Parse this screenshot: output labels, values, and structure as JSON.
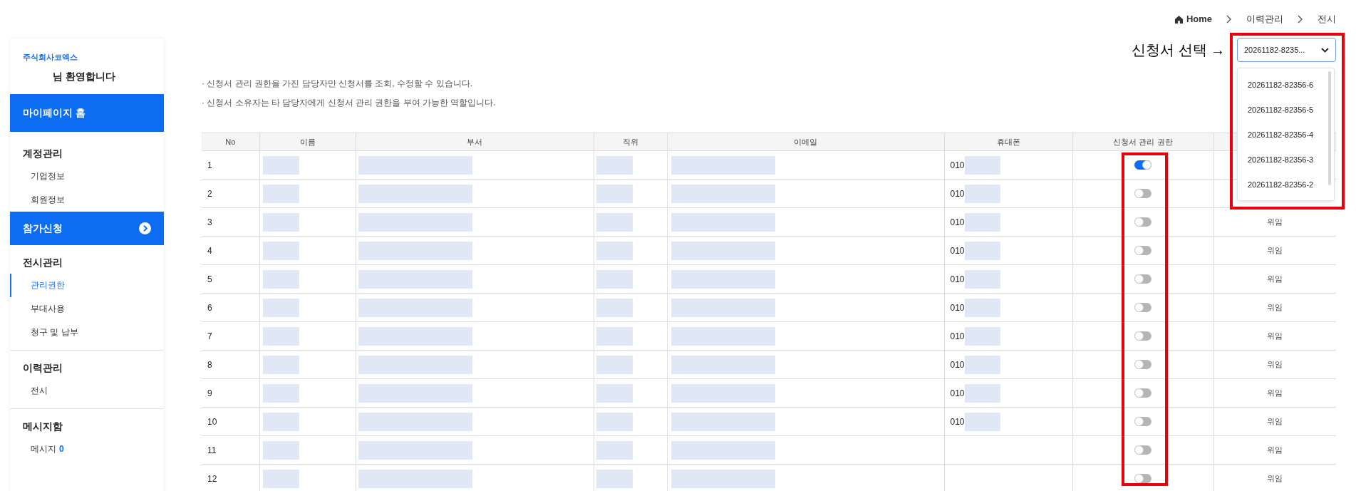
{
  "breadcrumb": [
    "Home",
    "이력관리",
    "전시"
  ],
  "sidebar": {
    "company": "주식회사코엑스",
    "welcome": "님 환영합니다",
    "sections": [
      {
        "kind": "band",
        "title": "마이페이지 홈",
        "chevron": false
      },
      {
        "kind": "group",
        "title": "계정관리",
        "items": [
          {
            "label": "기업정보",
            "selected": false
          },
          {
            "label": "회원정보",
            "selected": false
          }
        ]
      },
      {
        "kind": "band",
        "title": "참가신청",
        "chevron": true
      },
      {
        "kind": "group",
        "title": "전시관리",
        "items": [
          {
            "label": "관리권한",
            "selected": true
          },
          {
            "label": "부대사용",
            "selected": false
          },
          {
            "label": "청구 및 납부",
            "selected": false
          }
        ]
      },
      {
        "kind": "group",
        "title": "이력관리",
        "items": [
          {
            "label": "전시",
            "selected": false
          }
        ]
      },
      {
        "kind": "group",
        "title": "메시지함",
        "items": [
          {
            "label": "메시지",
            "selected": false,
            "count": "0"
          }
        ]
      }
    ]
  },
  "notes": [
    "· 신청서 관리 권한을 가진 담당자만 신청서를 조회, 수정할 수 있습니다.",
    "· 신청서 소유자는 타 담당자에게 신청서 관리 권한을 부여 가능한 역할입니다."
  ],
  "annotation": {
    "label": "신청서 선택 →"
  },
  "select": {
    "value": "20261182-8235...",
    "expanded": true,
    "options": [
      "20261182-82356-6",
      "20261182-82356-5",
      "20261182-82356-4",
      "20261182-82356-3",
      "20261182-82356-2"
    ]
  },
  "table": {
    "columns": [
      "No",
      "이름",
      "부서",
      "직위",
      "이메일",
      "휴대폰",
      "신청서 관리 권한"
    ],
    "rows": [
      {
        "no": "1",
        "phone_prefix": "010",
        "permission_on": true
      },
      {
        "no": "2",
        "phone_prefix": "010",
        "permission_on": false
      },
      {
        "no": "3",
        "phone_prefix": "010",
        "permission_on": false,
        "delegate": "위임"
      },
      {
        "no": "4",
        "phone_prefix": "010",
        "permission_on": false,
        "delegate": "위임"
      },
      {
        "no": "5",
        "phone_prefix": "010",
        "permission_on": false,
        "delegate": "위임"
      },
      {
        "no": "6",
        "phone_prefix": "010",
        "permission_on": false,
        "delegate": "위임"
      },
      {
        "no": "7",
        "phone_prefix": "010",
        "permission_on": false,
        "delegate": "위임"
      },
      {
        "no": "8",
        "phone_prefix": "010",
        "permission_on": false,
        "delegate": "위임"
      },
      {
        "no": "9",
        "phone_prefix": "010",
        "permission_on": false,
        "delegate": "위임"
      },
      {
        "no": "10",
        "phone_prefix": "010",
        "permission_on": false,
        "delegate": "위임"
      },
      {
        "no": "11",
        "permission_on": false,
        "delegate": "위임"
      },
      {
        "no": "12",
        "permission_on": false,
        "delegate": "위임"
      }
    ]
  }
}
